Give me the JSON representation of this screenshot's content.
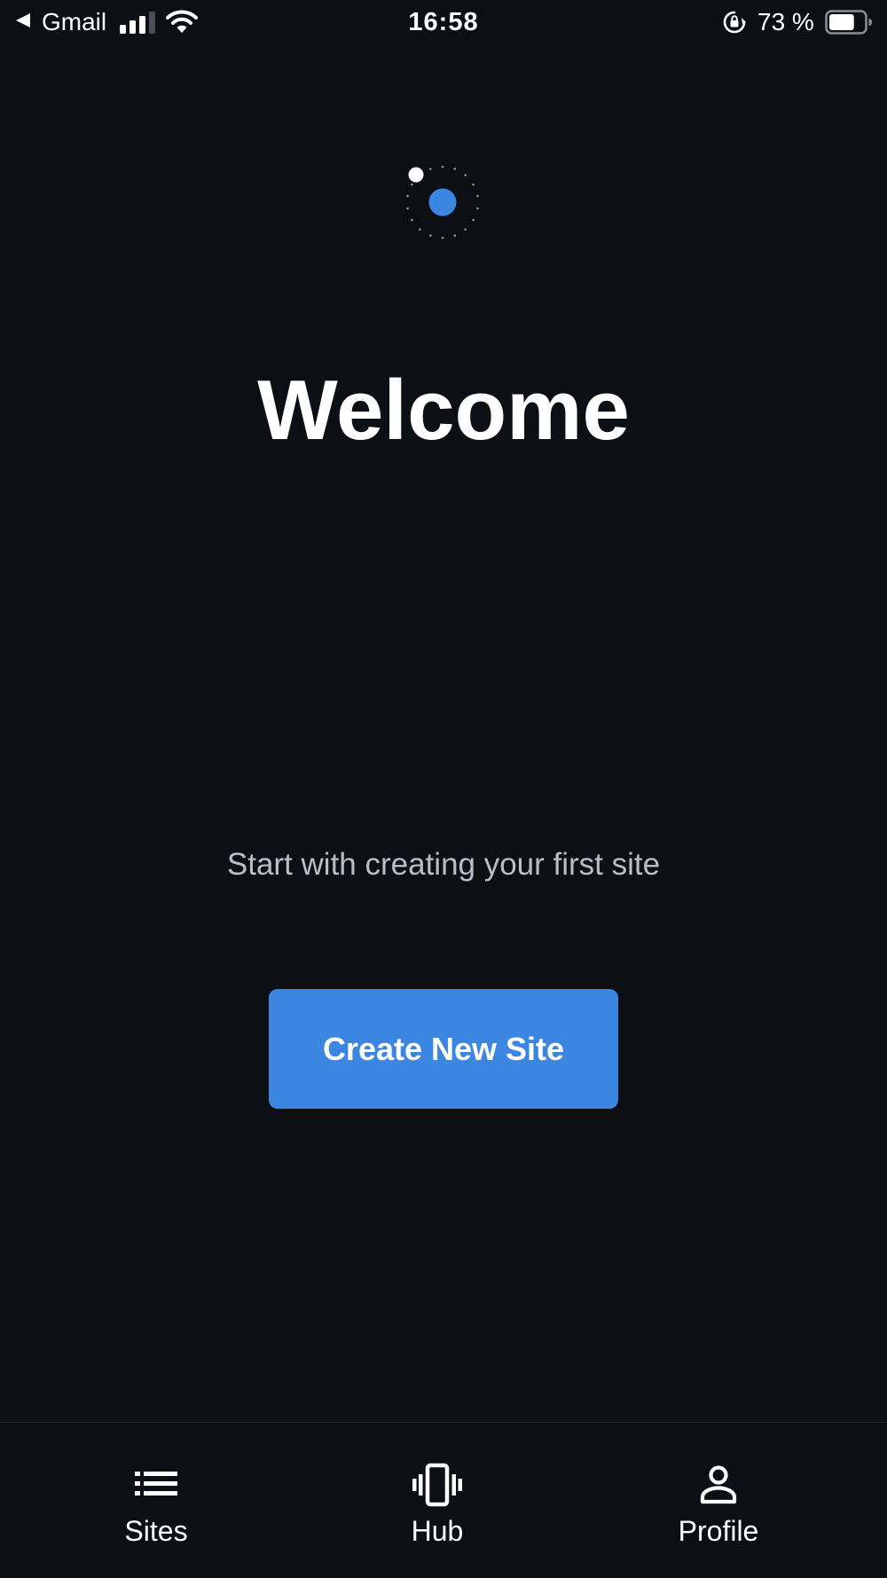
{
  "status_bar": {
    "back_icon": "back-triangle-icon",
    "back_app": "Gmail",
    "time": "16:58",
    "battery_percent": "73 %",
    "battery_level": 0.73,
    "icons": [
      "signal-icon",
      "wifi-icon",
      "orientation-lock-icon",
      "battery-icon"
    ]
  },
  "logo": {
    "icon": "loading-spinner-logo-icon",
    "accent_color": "#3a86e1"
  },
  "main": {
    "title": "Welcome",
    "subtitle": "Start with creating your first site",
    "create_button_label": "Create New Site"
  },
  "tab_bar": {
    "items": [
      {
        "label": "Sites",
        "icon": "list-icon"
      },
      {
        "label": "Hub",
        "icon": "vibrating-device-icon"
      },
      {
        "label": "Profile",
        "icon": "person-icon"
      }
    ]
  },
  "colors": {
    "background": "#0c0f14",
    "accent": "#3a86e1",
    "text_primary": "#ffffff",
    "text_secondary": "#b8bfc8"
  }
}
